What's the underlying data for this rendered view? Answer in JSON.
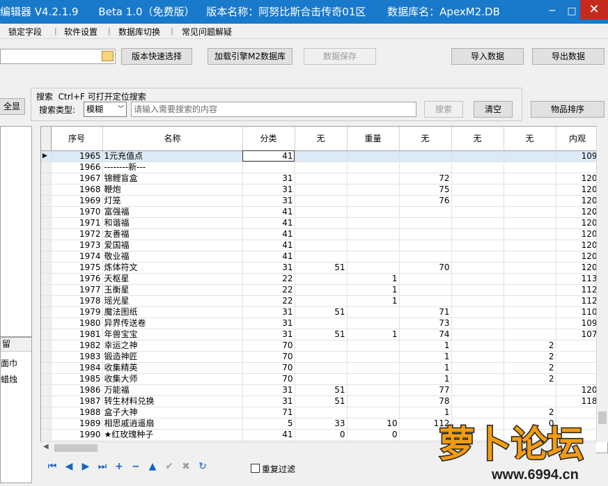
{
  "title": {
    "app": "编辑器 V4.2.1.9",
    "edition": "Beta 1.0（免费版）",
    "version_name": "版本名称：阿努比斯合击传奇01区",
    "db_name": "数据库名：ApexM2.DB",
    "window_minimize": "─",
    "window_maximize": "□",
    "window_close": "✕"
  },
  "menu": [
    "锁定字段",
    "软件设置",
    "数据库切换",
    "常见问题解疑"
  ],
  "toolbar": {
    "version_select": "版本快速选择",
    "load_engine": "加载引擎M2数据库",
    "save_data": "数据保存",
    "import_data": "导入数据",
    "export_data": "导出数据",
    "show_all": "全显"
  },
  "search": {
    "hint": "搜索  Ctrl+F 可打开定位搜索",
    "type_label": "搜索类型:",
    "type_value": "模糊",
    "placeholder": "请输入需要搜索的内容",
    "search_button": "搜索",
    "clear_button": "清空",
    "sort_button": "物品排序"
  },
  "left_panel": {
    "header": "留",
    "items": [
      "面巾",
      "蜡烛"
    ]
  },
  "grid": {
    "columns": [
      "序号",
      "名称",
      "分类",
      "无",
      "重量",
      "无",
      "无",
      "无",
      "内观"
    ],
    "rows": [
      [
        "1965",
        "1元充值点",
        "41",
        "",
        "",
        "",
        "",
        "",
        "109"
      ],
      [
        "1966",
        "--------新---",
        "",
        "",
        "",
        "",
        "",
        "",
        ""
      ],
      [
        "1967",
        "锦鲤盲盒",
        "31",
        "",
        "",
        "72",
        "",
        "",
        "120"
      ],
      [
        "1968",
        "鞭炮",
        "31",
        "",
        "",
        "75",
        "",
        "",
        "120"
      ],
      [
        "1969",
        "灯笼",
        "31",
        "",
        "",
        "76",
        "",
        "",
        "120"
      ],
      [
        "1970",
        "富强福",
        "41",
        "",
        "",
        "",
        "",
        "",
        "120"
      ],
      [
        "1971",
        "和谐福",
        "41",
        "",
        "",
        "",
        "",
        "",
        "120"
      ],
      [
        "1972",
        "友善福",
        "41",
        "",
        "",
        "",
        "",
        "",
        "120"
      ],
      [
        "1973",
        "爱国福",
        "41",
        "",
        "",
        "",
        "",
        "",
        "120"
      ],
      [
        "1974",
        "敬业福",
        "41",
        "",
        "",
        "",
        "",
        "",
        "120"
      ],
      [
        "1975",
        "炼体符文",
        "31",
        "51",
        "",
        "70",
        "",
        "",
        "120"
      ],
      [
        "1976",
        "天枢星",
        "22",
        "",
        "1",
        "",
        "",
        "",
        "113"
      ],
      [
        "1977",
        "玉衡星",
        "22",
        "",
        "1",
        "",
        "",
        "",
        "112"
      ],
      [
        "1978",
        "瑶光星",
        "22",
        "",
        "1",
        "",
        "",
        "",
        "112"
      ],
      [
        "1979",
        "魔法图纸",
        "31",
        "51",
        "",
        "71",
        "",
        "",
        "110"
      ],
      [
        "1980",
        "异界传送卷",
        "31",
        "",
        "",
        "73",
        "",
        "",
        "109"
      ],
      [
        "1981",
        "年兽宝宝",
        "31",
        "51",
        "1",
        "74",
        "",
        "",
        "107"
      ],
      [
        "1982",
        "幸运之神",
        "70",
        "",
        "",
        "1",
        "",
        "2",
        ""
      ],
      [
        "1983",
        "锻造神匠",
        "70",
        "",
        "",
        "1",
        "",
        "2",
        ""
      ],
      [
        "1984",
        "收集精英",
        "70",
        "",
        "",
        "1",
        "",
        "2",
        ""
      ],
      [
        "1985",
        "收集大师",
        "70",
        "",
        "",
        "1",
        "",
        "2",
        ""
      ],
      [
        "1986",
        "万能福",
        "31",
        "51",
        "",
        "77",
        "",
        "",
        "120"
      ],
      [
        "1987",
        "转生材料兑换",
        "31",
        "51",
        "",
        "78",
        "",
        "",
        "118"
      ],
      [
        "1988",
        "盒子大神",
        "71",
        "",
        "",
        "1",
        "",
        "2",
        ""
      ],
      [
        "1989",
        "相思戚逍遥扇",
        "5",
        "33",
        "10",
        "112",
        "",
        "0",
        ""
      ],
      [
        "1990",
        "★红玫瑰种子",
        "41",
        "0",
        "0",
        "",
        "",
        "",
        ""
      ]
    ]
  },
  "bottom": {
    "dedupe_label": "重复过滤",
    "dedupe_checked": false
  },
  "watermark": {
    "text": "萝卜论坛",
    "url": "www.6994.cn"
  },
  "colors": {
    "titlebar": "#1979ca",
    "selection": "#dce9f7",
    "watermark_orange": "#f39c12"
  }
}
